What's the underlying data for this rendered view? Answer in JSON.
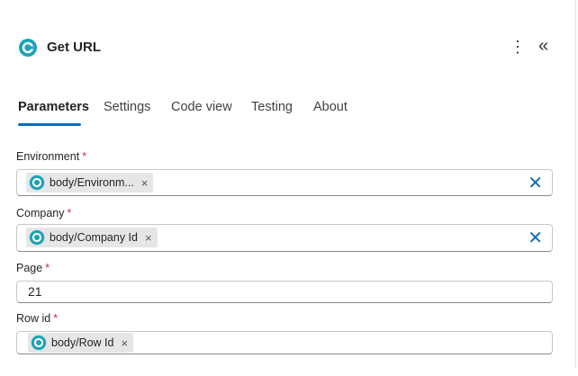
{
  "header": {
    "title": "Get URL",
    "more_icon": "more-vertical-icon",
    "collapse_icon": "double-chevron-left-icon"
  },
  "tabs": [
    {
      "label": "Parameters",
      "active": true
    },
    {
      "label": "Settings"
    },
    {
      "label": "Code view"
    },
    {
      "label": "Testing"
    },
    {
      "label": "About"
    }
  ],
  "fields": [
    {
      "label": "Environment",
      "required": "*",
      "token": "body/Environm..."
    },
    {
      "label": "Company",
      "required": "*",
      "token": "body/Company Id"
    },
    {
      "label": "Page",
      "required": "*",
      "value": "21"
    },
    {
      "label": "Row id",
      "required": "*",
      "token": "body/Row Id"
    }
  ],
  "icons": {
    "token_remove": "×",
    "clear": "✕"
  },
  "colors": {
    "accent": "#0f6cbd",
    "logo": "#1ba3b8"
  }
}
